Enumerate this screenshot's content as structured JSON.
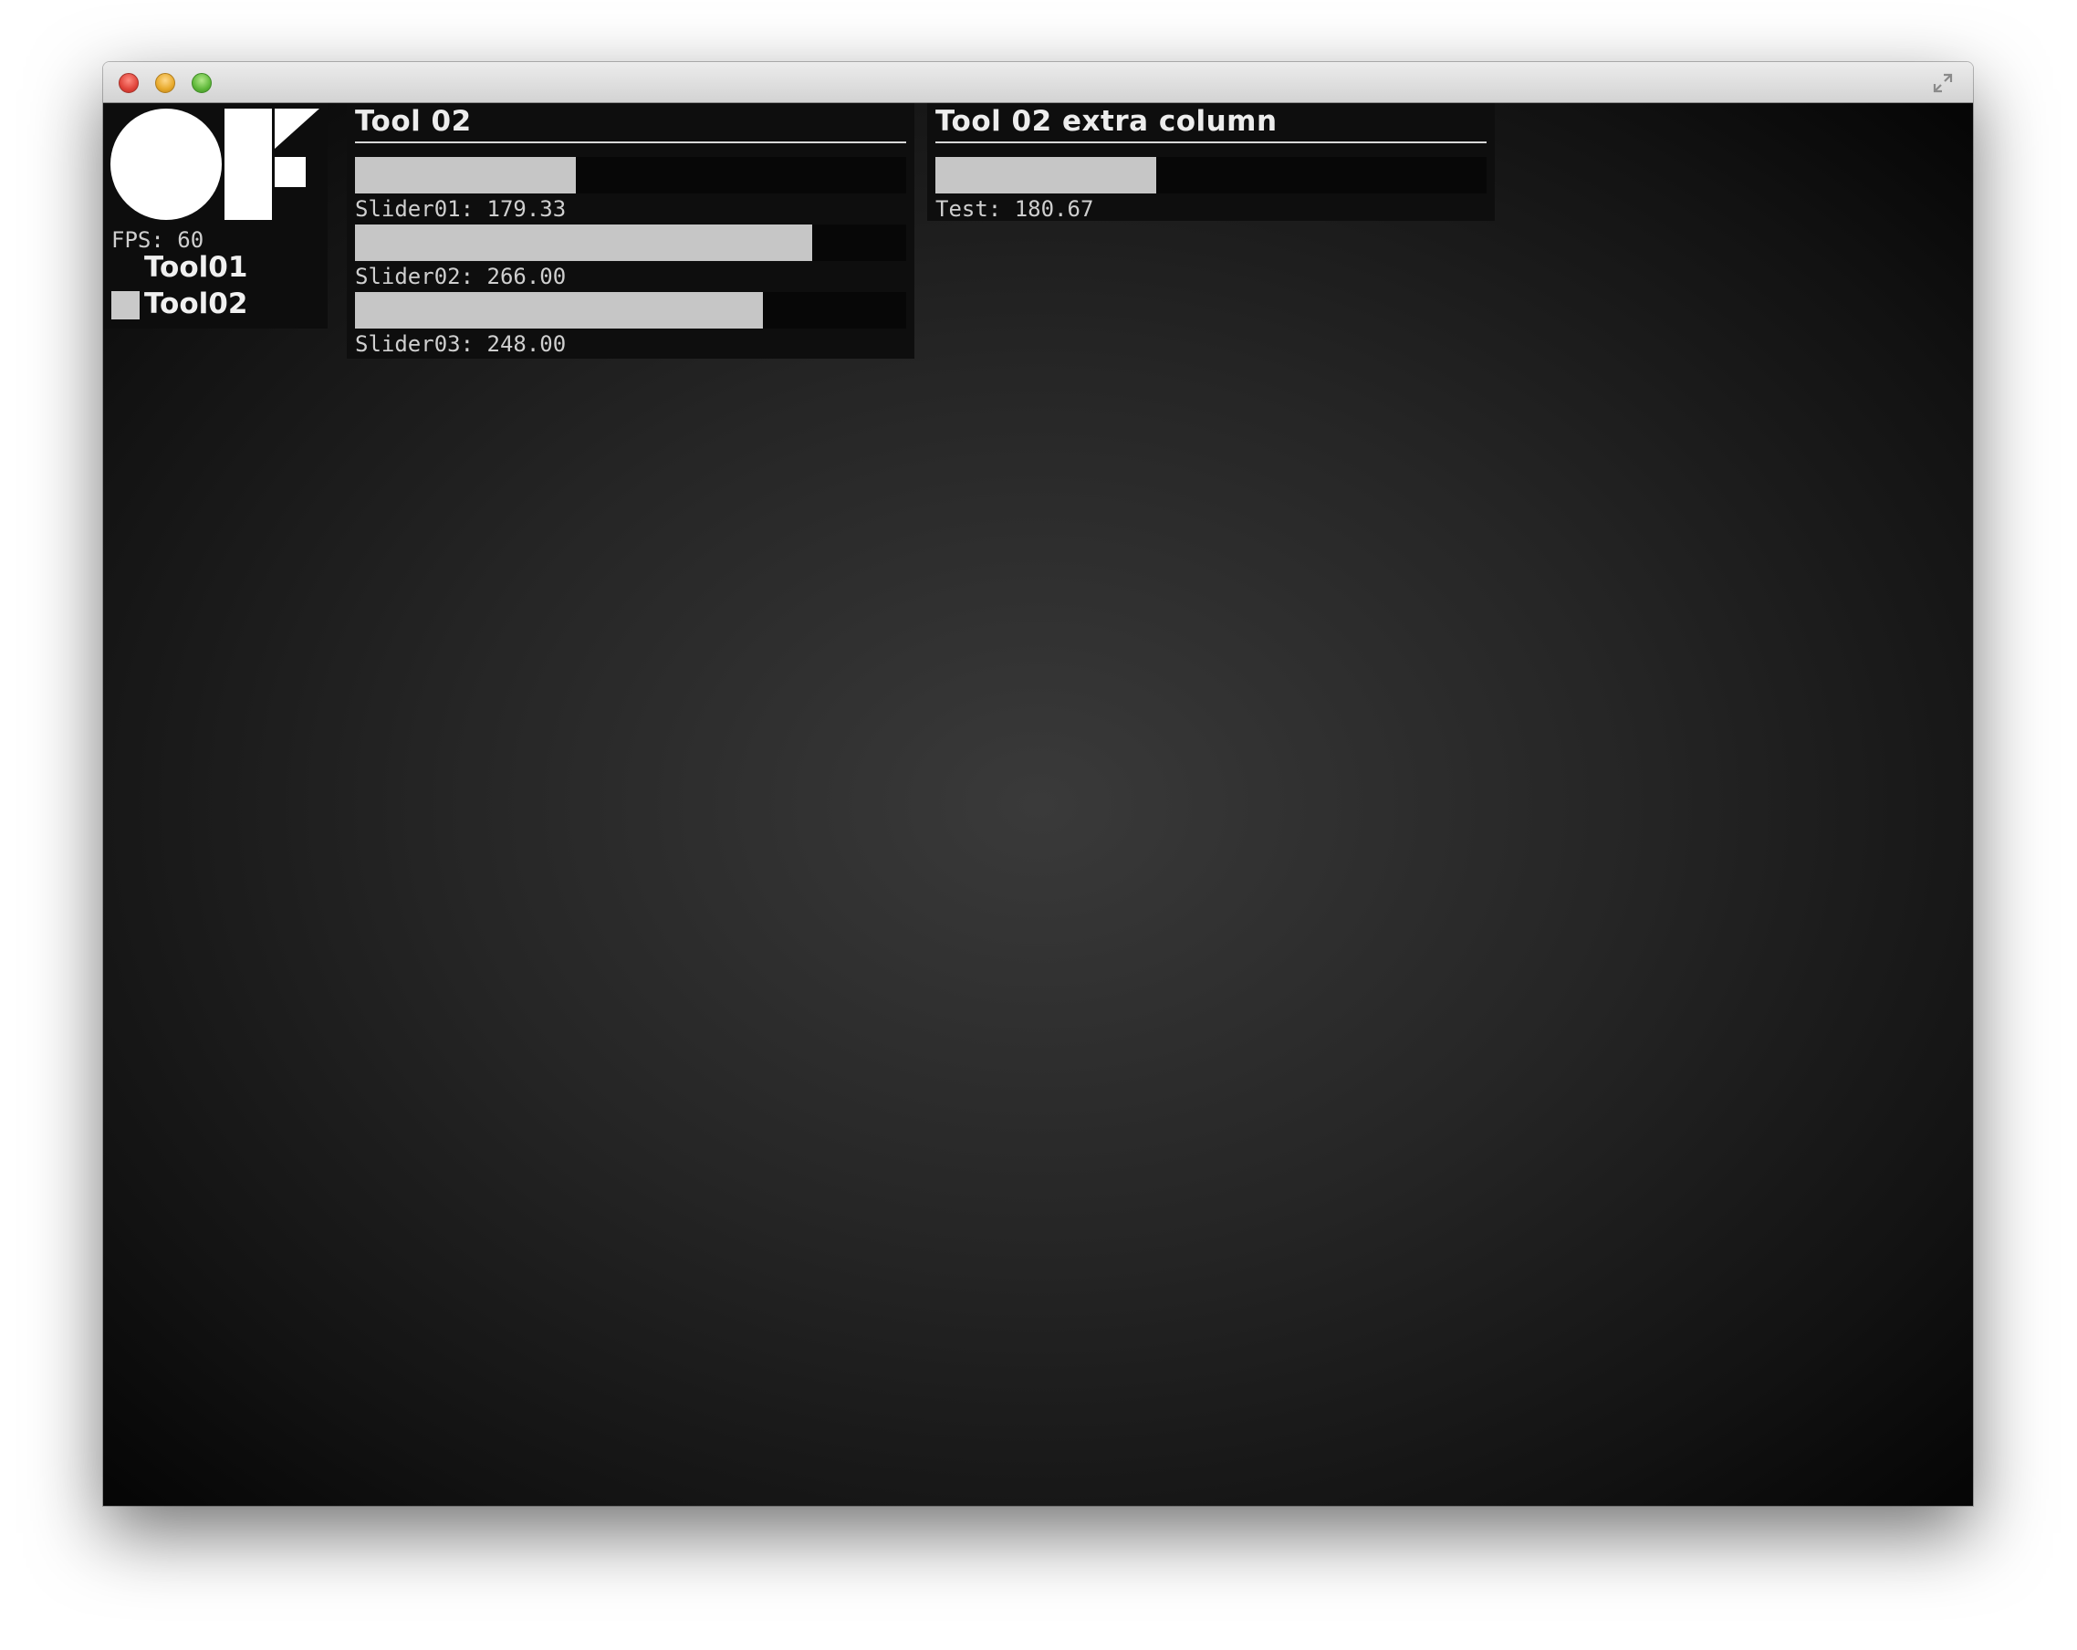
{
  "window": {
    "controls": {
      "close_color": "#e0443a",
      "minimize_color": "#e7a92b",
      "maximize_color": "#5fb83a"
    },
    "fullscreen_icon": "fullscreen-arrows-icon"
  },
  "sidebar": {
    "logo_icon": "openframeworks-logo-icon",
    "fps_text": "FPS: 60",
    "tools": [
      {
        "label": "Tool01",
        "active": false
      },
      {
        "label": "Tool02",
        "active": true
      }
    ]
  },
  "panels": [
    {
      "title": "Tool 02",
      "sliders": [
        {
          "label": "Slider01: 179.33",
          "value": 179.33,
          "fill_fraction": 0.4
        },
        {
          "label": "Slider02: 266.00",
          "value": 266.0,
          "fill_fraction": 0.83
        },
        {
          "label": "Slider03: 248.00",
          "value": 248.0,
          "fill_fraction": 0.74
        }
      ]
    },
    {
      "title": "Tool 02 extra column",
      "sliders": [
        {
          "label": "Test: 180.67",
          "value": 180.67,
          "fill_fraction": 0.4
        }
      ]
    }
  ],
  "colors": {
    "slider_fill": "#c6c6c6",
    "slider_track": "#070707",
    "panel_bg": "#0e0e0e"
  }
}
